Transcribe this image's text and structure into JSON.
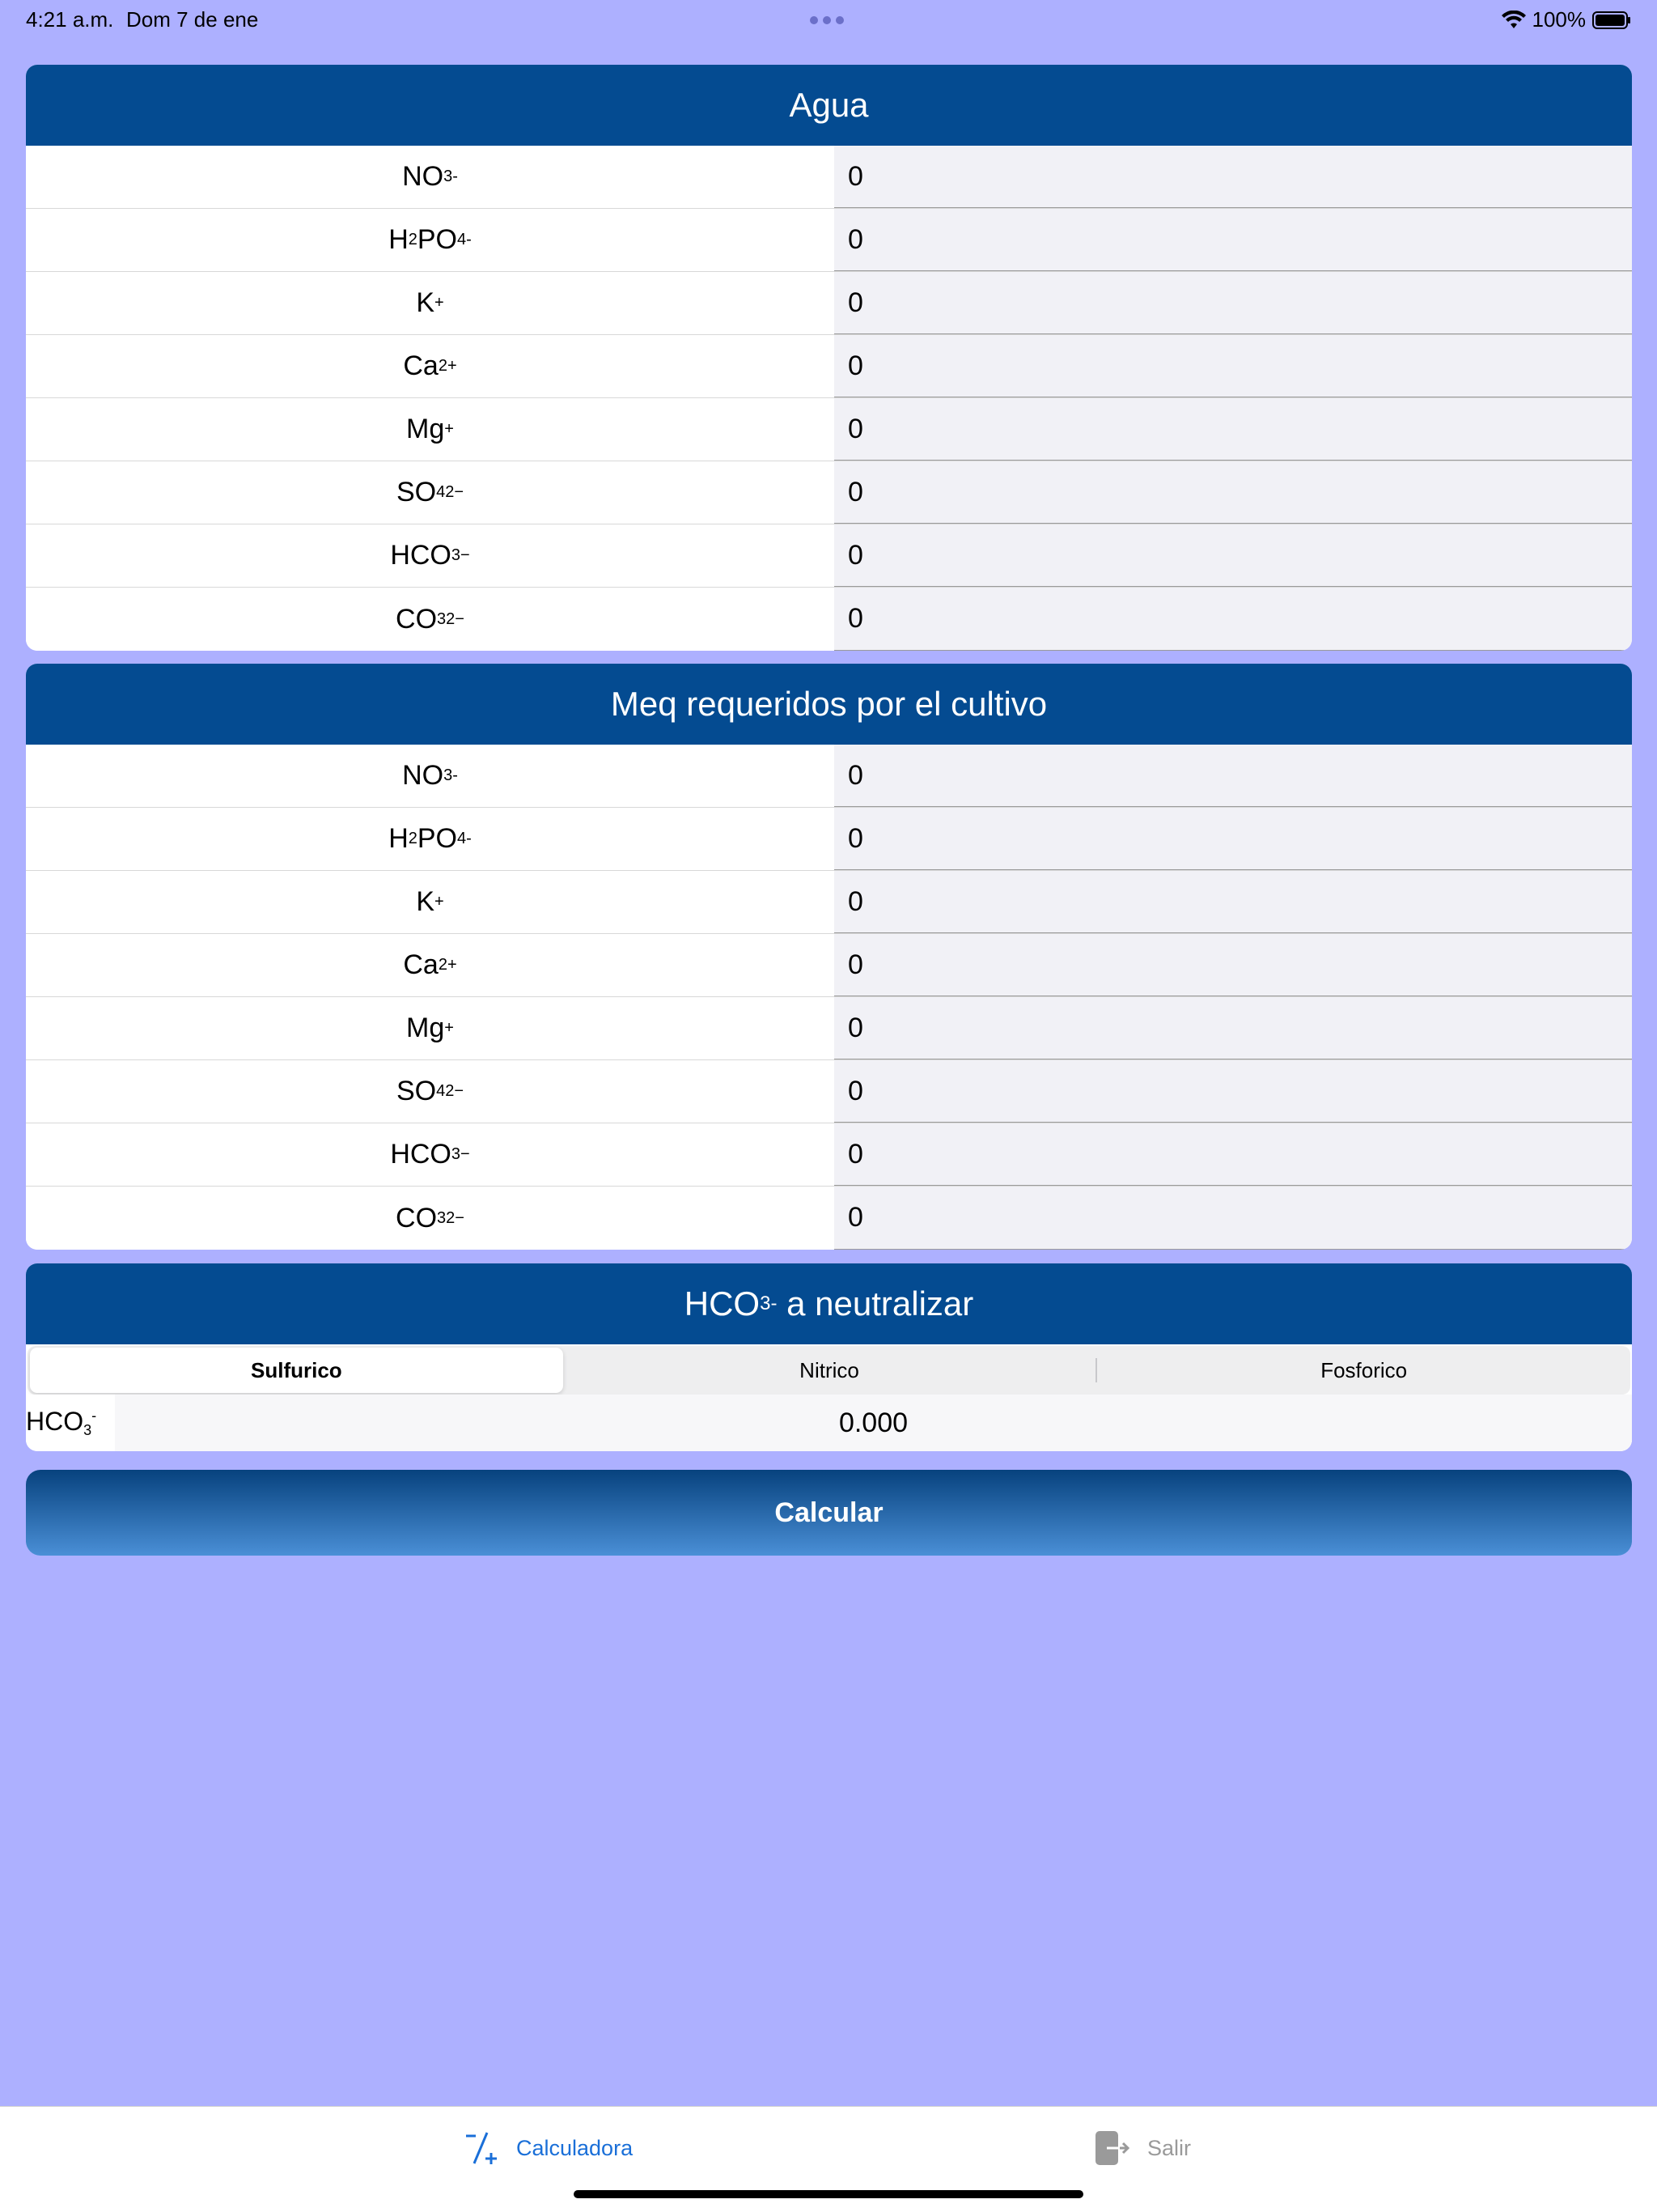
{
  "status": {
    "time": "4:21 a.m.",
    "date": "Dom 7 de ene",
    "battery": "100%"
  },
  "agua": {
    "title": "Agua",
    "rows": [
      {
        "base": "NO",
        "sub": "3",
        "sup": "-",
        "value": "0"
      },
      {
        "base": "H",
        "sub1": "2",
        "base2": "PO",
        "sub": "4",
        "sup": "-",
        "value": "0"
      },
      {
        "base": "K",
        "sub": "",
        "sup": "+",
        "value": "0"
      },
      {
        "base": "Ca",
        "sub": "",
        "sup": "2+",
        "value": "0"
      },
      {
        "base": "Mg",
        "sub": "",
        "sup": "+",
        "value": "0"
      },
      {
        "base": "SO",
        "sub": "4",
        "sup": "2−",
        "value": "0"
      },
      {
        "base": "HCO",
        "sub": "3",
        "sup": "−",
        "value": "0"
      },
      {
        "base": "CO",
        "sub": "3",
        "sup": "2−",
        "value": "0"
      }
    ]
  },
  "meq": {
    "title": "Meq requeridos por el cultivo",
    "rows": [
      {
        "base": "NO",
        "sub": "3",
        "sup": "-",
        "value": "0"
      },
      {
        "base": "H",
        "sub1": "2",
        "base2": "PO",
        "sub": "4",
        "sup": "-",
        "value": "0"
      },
      {
        "base": "K",
        "sub": "",
        "sup": "+",
        "value": "0"
      },
      {
        "base": "Ca",
        "sub": "",
        "sup": "2+",
        "value": "0"
      },
      {
        "base": "Mg",
        "sub": "",
        "sup": "+",
        "value": "0"
      },
      {
        "base": "SO",
        "sub": "4",
        "sup": "2−",
        "value": "0"
      },
      {
        "base": "HCO",
        "sub": "3",
        "sup": "−",
        "value": "0"
      },
      {
        "base": "CO",
        "sub": "3",
        "sup": "2−",
        "value": "0"
      }
    ]
  },
  "neutralizar": {
    "title_base": "HCO",
    "title_sub": "3",
    "title_sup": "-",
    "title_rest": " a neutralizar",
    "segments": [
      "Sulfurico",
      "Nitrico",
      "Fosforico"
    ],
    "selected": "Sulfurico",
    "result_label_base": "HCO",
    "result_label_sub": "3",
    "result_label_sup": "-",
    "result_value": "0.000"
  },
  "calc_button": "Calcular",
  "tabs": [
    {
      "label": "Calculadora",
      "icon": "calculator-icon",
      "active": true
    },
    {
      "label": "Salir",
      "icon": "exit-icon",
      "active": false
    }
  ],
  "colors": {
    "header": "#044b91",
    "background": "#adb0ff",
    "active_tab": "#1a6fd8"
  }
}
